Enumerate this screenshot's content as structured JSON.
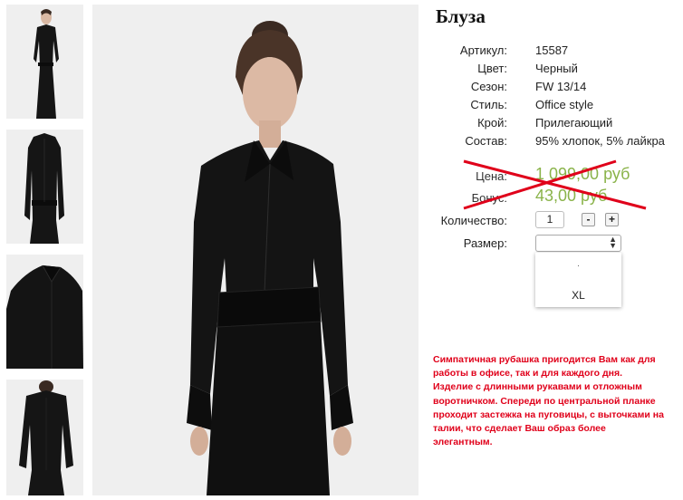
{
  "product": {
    "title": "Блуза",
    "specs": [
      {
        "label": "Артикул:",
        "value": "15587"
      },
      {
        "label": "Цвет:",
        "value": "Черный"
      },
      {
        "label": "Сезон:",
        "value": "FW 13/14"
      },
      {
        "label": "Стиль:",
        "value": "Office style"
      },
      {
        "label": "Крой:",
        "value": "Прилегающий"
      },
      {
        "label": "Состав:",
        "value": "95% хлопок, 5% лайкра"
      }
    ],
    "price_label": "Цена:",
    "price_value": "1 099,00 руб",
    "bonus_label": "Бонус:",
    "bonus_value": "43,00 руб",
    "quantity_label": "Количество:",
    "quantity_value": "1",
    "minus": "-",
    "plus": "+",
    "size_label": "Размер:",
    "size_options": [
      ".",
      "XL"
    ],
    "description": "Симпатичная рубашка пригодится Вам как для работы в офисе, так и для каждого дня. Изделие с длинными рукавами и отложным воротничком. Спереди по центральной планке проходит застежка на пуговицы, с выточками на талии, что сделает Ваш образ более элегантным."
  },
  "colors": {
    "price": "#8ab34a",
    "strike": "#e0001a",
    "description": "#e0001a"
  },
  "icons": [
    "select-arrows-icon"
  ]
}
